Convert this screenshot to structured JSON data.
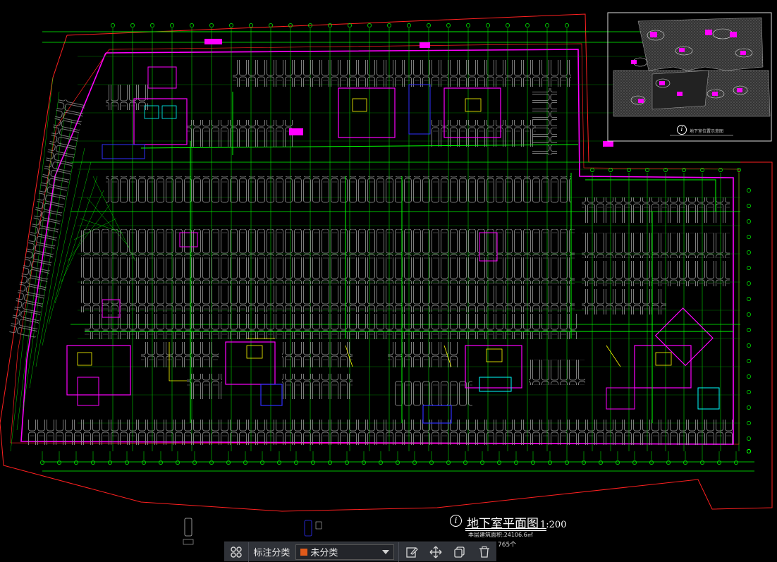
{
  "drawing": {
    "title": "地下室平面图",
    "scale": "1:200",
    "subtitle": "本层建筑面积:24106.6㎡",
    "count": "765个",
    "inset_caption": "地下室位置示意图",
    "info_symbol": "i"
  },
  "toolbar": {
    "label": "标注分类",
    "selected": "未分类",
    "selected_color": "#e05a1a",
    "icons": [
      "grid-apps-icon",
      "edit-icon",
      "move-icon",
      "copy-icon",
      "delete-icon"
    ]
  },
  "colors": {
    "background": "#000000",
    "wall": "#ff00ff",
    "axis": "#00ff00",
    "grid": "#00ffff",
    "parking": "#9a9a9a",
    "boundary": "#ff2020",
    "yellow": "#ffff00",
    "blue": "#3030ff"
  }
}
